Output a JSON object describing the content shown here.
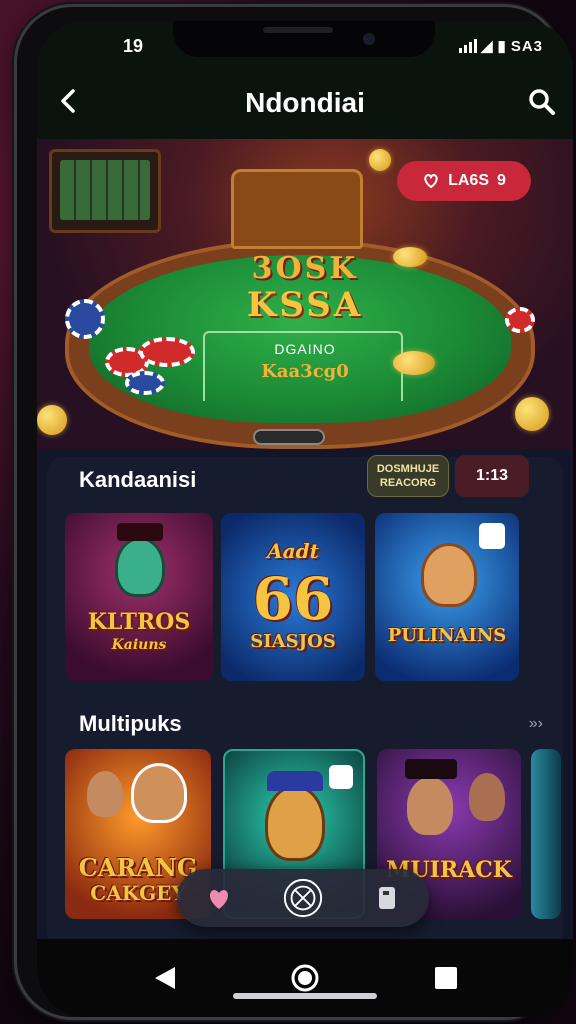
{
  "status_bar": {
    "time": "19",
    "icons_text": "SA3"
  },
  "app_bar": {
    "title": "Ndondiai"
  },
  "hero": {
    "headline_1": "3OSK",
    "headline_2": "KSSA",
    "felt_label": "DGAINO",
    "felt_name": "Kaa3cg0",
    "pill_label": "LA6S",
    "pill_count": "9"
  },
  "section_1": {
    "title": "Kandaanisi",
    "tag_a": "DOSMHUJE\nREACORG",
    "tag_b": "1:13",
    "cards": [
      {
        "label": "KLTROS",
        "sublabel": "Kaiuns"
      },
      {
        "label": "66",
        "top": "Aadt",
        "sublabel": "SIASJOS"
      },
      {
        "label": "PULINAINS"
      }
    ]
  },
  "section_2": {
    "title": "Multipuks",
    "more": "»›",
    "cards": [
      {
        "label": "CARANG",
        "sublabel": "CAKGEY"
      },
      {
        "label": ""
      },
      {
        "label": "MUIRACK"
      }
    ]
  },
  "colors": {
    "accent_red": "#c8283a",
    "gold": "#f5c542",
    "felt_green": "#1b8a36",
    "panel": "#161b2e"
  },
  "icons": [
    "back-arrow-icon",
    "search-icon",
    "heart-icon",
    "compass-icon",
    "phone-icon",
    "nav-back-icon",
    "nav-home-icon",
    "nav-recents-icon"
  ]
}
